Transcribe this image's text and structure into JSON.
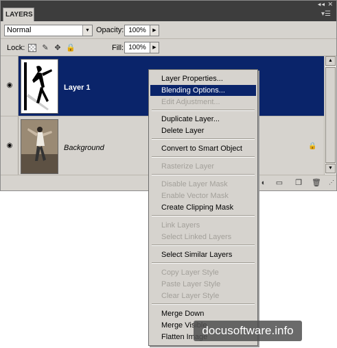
{
  "panel": {
    "tab_label": "LAYERS",
    "blend_mode": "Normal",
    "opacity_label": "Opacity:",
    "opacity_value": "100%",
    "lock_label": "Lock:",
    "fill_label": "Fill:",
    "fill_value": "100%"
  },
  "layers": [
    {
      "name": "Layer 1",
      "selected": true,
      "visible": true
    },
    {
      "name": "Background",
      "selected": false,
      "visible": true,
      "locked": true
    }
  ],
  "context_menu": {
    "items": [
      {
        "label": "Layer Properties...",
        "enabled": true
      },
      {
        "label": "Blending Options...",
        "enabled": true,
        "highlighted": true
      },
      {
        "label": "Edit Adjustment...",
        "enabled": false
      },
      {
        "label": "Duplicate Layer...",
        "enabled": true
      },
      {
        "label": "Delete Layer",
        "enabled": true
      },
      {
        "label": "Convert to Smart Object",
        "enabled": true
      },
      {
        "label": "Rasterize Layer",
        "enabled": false
      },
      {
        "label": "Disable Layer Mask",
        "enabled": false
      },
      {
        "label": "Enable Vector Mask",
        "enabled": false
      },
      {
        "label": "Create Clipping Mask",
        "enabled": true
      },
      {
        "label": "Link Layers",
        "enabled": false
      },
      {
        "label": "Select Linked Layers",
        "enabled": false
      },
      {
        "label": "Select Similar Layers",
        "enabled": true
      },
      {
        "label": "Copy Layer Style",
        "enabled": false
      },
      {
        "label": "Paste Layer Style",
        "enabled": false
      },
      {
        "label": "Clear Layer Style",
        "enabled": false
      },
      {
        "label": "Merge Down",
        "enabled": true
      },
      {
        "label": "Merge Visible",
        "enabled": true
      },
      {
        "label": "Flatten Image",
        "enabled": true
      }
    ]
  },
  "watermark": "docusoftware.info",
  "colors": {
    "selection": "#0a246a",
    "panel_bg": "#d6d3ce",
    "disabled_text": "#a3a09a"
  },
  "icons": [
    "panel-close-icon",
    "panel-menu-icon",
    "dropdown-arrow-icon",
    "lock-transparent-icon",
    "lock-image-icon",
    "lock-position-icon",
    "lock-all-icon",
    "eye-icon",
    "lock-badge-icon",
    "new-group-icon",
    "new-layer-icon",
    "trash-icon"
  ]
}
